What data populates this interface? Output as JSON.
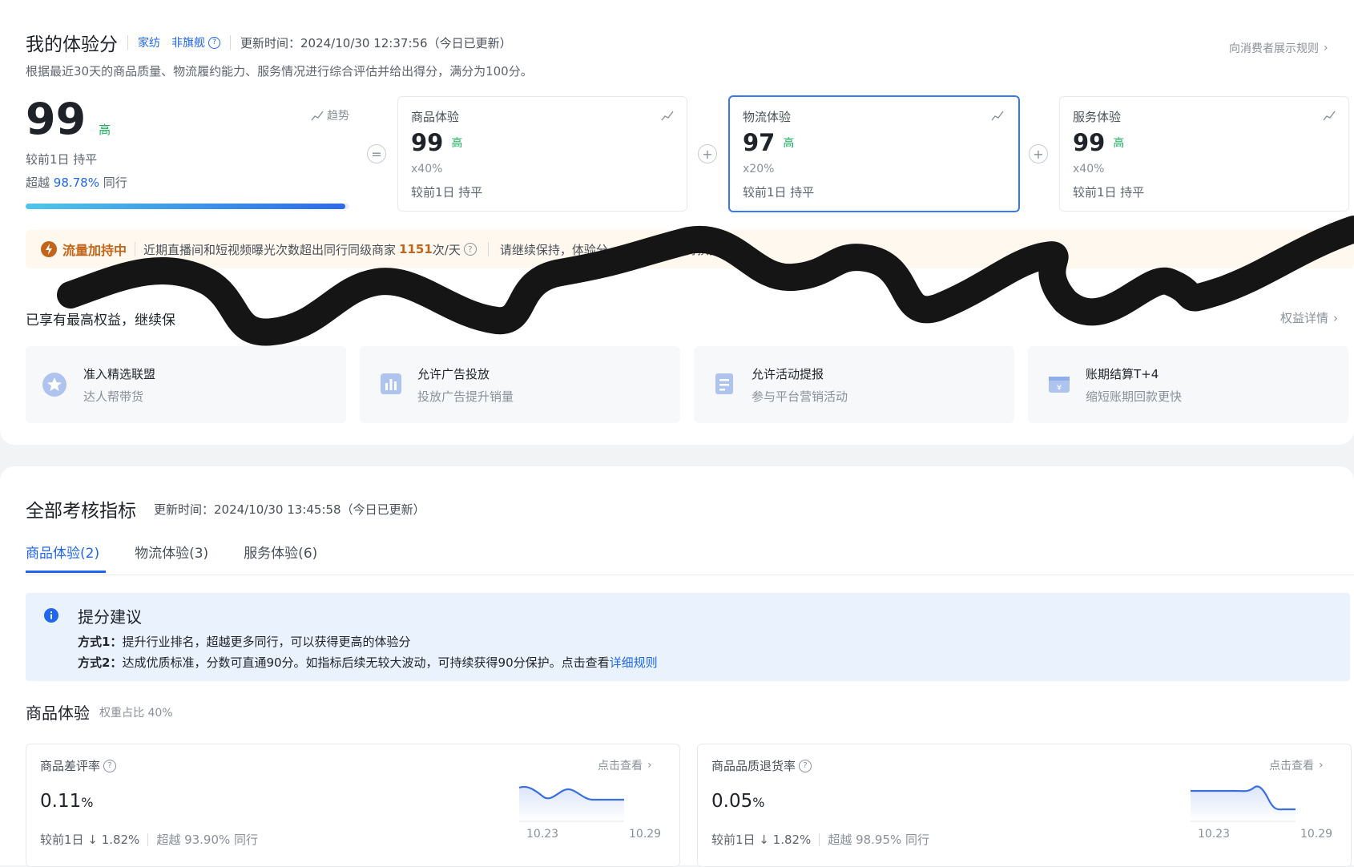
{
  "header": {
    "title": "我的体验分",
    "category": "家纺",
    "store_type": "非旗舰",
    "update_time": "更新时间：2024/10/30 12:37:56（今日已更新）",
    "consumer_rule_link": "向消费者展示规则",
    "description": "根据最近30天的商品质量、物流履约能力、服务情况进行综合评估并给出得分，满分为100分。"
  },
  "overall": {
    "score": "99",
    "level": "高",
    "trend_label": "趋势",
    "compare": "较前1日 持平",
    "beat_prefix": "超越 ",
    "beat_value": "98.78%",
    "beat_suffix": " 同行",
    "progress": 0.9878
  },
  "metrics": [
    {
      "name": "商品体验",
      "score": "99",
      "level": "高",
      "weight": "x40%",
      "compare": "较前1日 持平"
    },
    {
      "name": "物流体验",
      "score": "97",
      "level": "高",
      "weight": "x20%",
      "compare": "较前1日 持平"
    },
    {
      "name": "服务体验",
      "score": "99",
      "level": "高",
      "weight": "x40%",
      "compare": "较前1日 持平"
    }
  ],
  "operators": {
    "eq": "=",
    "plus": "+"
  },
  "traffic_bar": {
    "title": "流量加持中",
    "text_part1": "近期直播间和短视频曝光次数超出同行同级商家",
    "count": "1151",
    "unit": "次/天",
    "text_part2": "请继续保持，体验分",
    "text_part3": "得扶持越多！"
  },
  "benefits_section": {
    "title": "已享有最高权益，继续保",
    "detail_link": "权益详情",
    "items": [
      {
        "title": "准入精选联盟",
        "sub": "达人帮带货"
      },
      {
        "title": "允许广告投放",
        "sub": "投放广告提升销量"
      },
      {
        "title": "允许活动提报",
        "sub": "参与平台营销活动"
      },
      {
        "title": "账期结算T+4",
        "sub": "缩短账期回款更快"
      }
    ]
  },
  "indicators": {
    "title": "全部考核指标",
    "update_time": "更新时间：2024/10/30 13:45:58（今日已更新）",
    "tabs": [
      "商品体验(2)",
      "物流体验(3)",
      "服务体验(6)"
    ],
    "tip": {
      "title": "提分建议",
      "way1_label": "方式1：",
      "way1_text": "提升行业排名，超越更多同行，可以获得更高的体验分",
      "way2_label": "方式2：",
      "way2_text": "达成优质标准，分数可直通90分。如指标后续无较大波动，可持续获得90分保护。点击查看",
      "way2_link": "详细规则"
    },
    "section_title": "商品体验",
    "section_weight": "权重占比 40%",
    "cards": [
      {
        "label": "商品差评率",
        "value": "0.11",
        "value_unit": "%",
        "link": "点击查看",
        "compare": "较前1日 ↓ 1.82%",
        "beat": "超越 93.90% 同行",
        "axis_start": "10.23",
        "axis_end": "10.29",
        "line_color": "#3a6fe0"
      },
      {
        "label": "商品品质退货率",
        "value": "0.05",
        "value_unit": "%",
        "link": "点击查看",
        "compare": "较前1日 ↓ 1.82%",
        "beat": "超越 98.95% 同行",
        "axis_start": "10.23",
        "axis_end": "10.29",
        "line_color": "#3a6fe0"
      }
    ]
  },
  "colors": {
    "accent": "#1f66f0",
    "level_green": "#19b25a",
    "traffic_title": "#c2651a",
    "traffic_bg": "#fff8ee"
  }
}
